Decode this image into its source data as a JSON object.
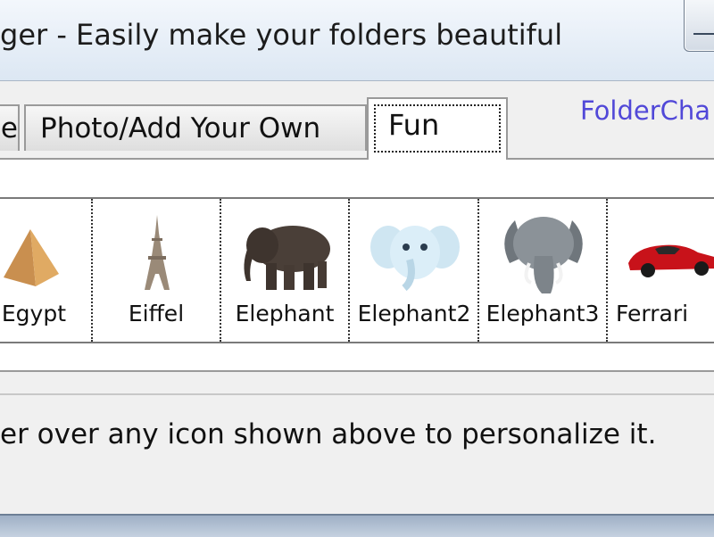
{
  "window": {
    "title": "ger - Easily make your folders beautiful"
  },
  "tabs": [
    {
      "label": "e",
      "active": false
    },
    {
      "label": "Photo/Add Your Own",
      "active": false
    },
    {
      "label": "Fun",
      "active": true
    }
  ],
  "brand_link": "FolderCha",
  "icons": [
    {
      "label": "Egypt",
      "icon": "pyramid-icon"
    },
    {
      "label": "Eiffel",
      "icon": "eiffel-tower-icon"
    },
    {
      "label": "Elephant",
      "icon": "elephant-icon"
    },
    {
      "label": "Elephant2",
      "icon": "cartoon-elephant-icon"
    },
    {
      "label": "Elephant3",
      "icon": "grey-elephant-icon"
    },
    {
      "label": "Ferrari",
      "icon": "red-car-icon"
    }
  ],
  "hint": "er over any icon shown above to personalize it.",
  "colors": {
    "link": "#5148d8",
    "titlebar": "#dce7f3"
  }
}
